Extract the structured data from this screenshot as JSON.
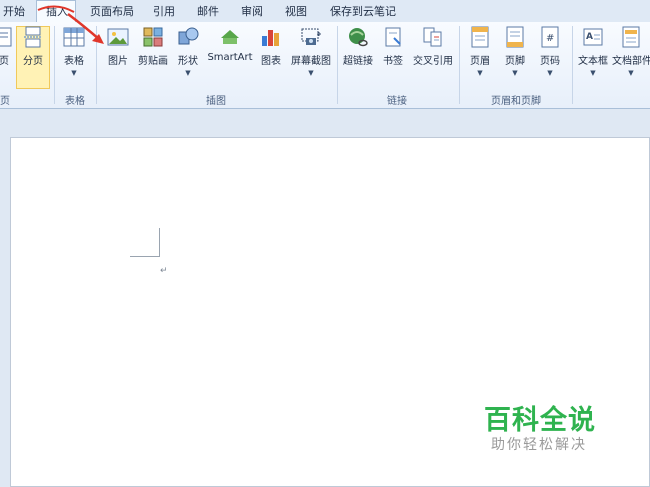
{
  "tabs": [
    "开始",
    "插入",
    "页面布局",
    "引用",
    "邮件",
    "审阅",
    "视图",
    "保存到云笔记"
  ],
  "active_tab": "插入",
  "ribbon": {
    "buttons": {
      "page_partial": "页",
      "page_break": "分页",
      "table": "表格",
      "picture": "图片",
      "clipart": "剪贴画",
      "shapes": "形状",
      "smartart": "SmartArt",
      "chart": "图表",
      "screenshot": "屏幕截图",
      "hyperlink": "超链接",
      "bookmark": "书签",
      "crossref": "交叉引用",
      "header": "页眉",
      "footer": "页脚",
      "page_number": "页码",
      "textbox": "文本框",
      "quickparts": "文档部件"
    },
    "groups": {
      "pages": "页",
      "tables": "表格",
      "illustrations": "插图",
      "links": "链接",
      "header_footer": "页眉和页脚"
    }
  },
  "document": {
    "paragraph_mark": "↵"
  },
  "watermark": {
    "main": "百科全说",
    "sub": "助你轻松解决"
  },
  "colors": {
    "accent_red": "#e0362a",
    "watermark_green": "#2fb34f"
  }
}
